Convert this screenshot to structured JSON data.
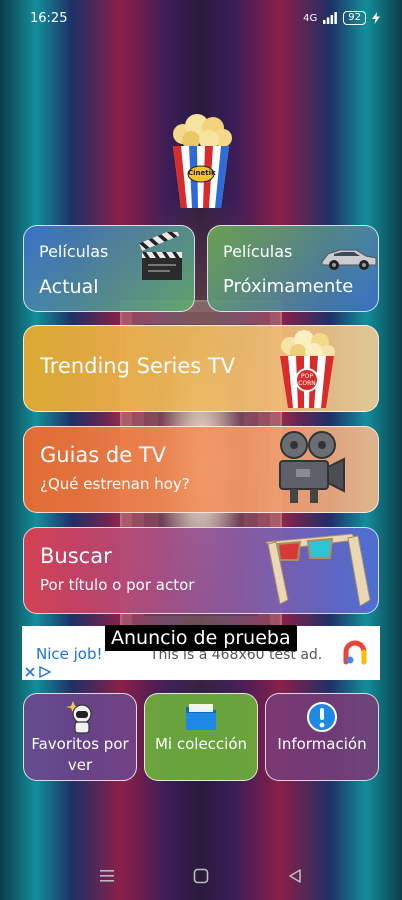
{
  "status_bar": {
    "time": "16:25",
    "network": "4G",
    "battery": "92"
  },
  "menu": {
    "peliculas_actual": {
      "line1": "Películas",
      "line2": "Actual",
      "icon": "clapperboard-icon"
    },
    "peliculas_proximamente": {
      "line1": "Películas",
      "line2": "Próximamente",
      "icon": "car-icon"
    },
    "trending": {
      "title": "Trending Series TV",
      "icon": "popcorn-icon"
    },
    "guias": {
      "title": "Guias de TV",
      "subtitle": "¿Qué estrenan hoy?",
      "icon": "film-camera-icon"
    },
    "buscar": {
      "title": "Buscar",
      "subtitle": "Por título o por actor",
      "icon": "3d-glasses-icon"
    }
  },
  "logo": {
    "text": "Cinetik"
  },
  "ad": {
    "label": "Anuncio de prueba",
    "nice": "Nice job!",
    "text": "This is a 468x60 test ad."
  },
  "bottom": {
    "favoritos": "Favoritos por ver",
    "coleccion": "Mi colección",
    "informacion": "Información"
  },
  "nav": [
    "menu-icon",
    "home-icon",
    "back-icon"
  ]
}
